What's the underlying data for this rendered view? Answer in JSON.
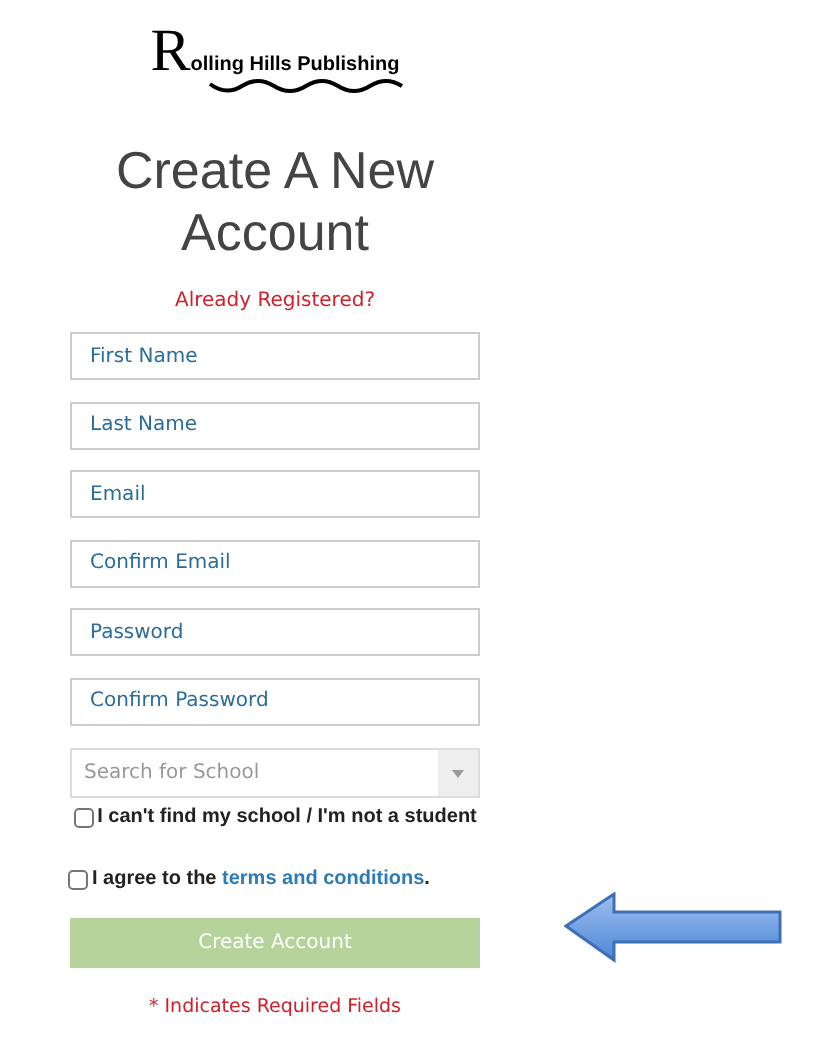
{
  "logo": "Rolling Hills Publishing",
  "title": "Create A New Account",
  "login_link": "Already Registered?",
  "fields": [
    {
      "placeholder": "First Name"
    },
    {
      "placeholder": "Last Name"
    },
    {
      "placeholder": "Email"
    },
    {
      "placeholder": "Confirm Email"
    },
    {
      "placeholder": "Password"
    },
    {
      "placeholder": "Confirm Password"
    }
  ],
  "school_select": {
    "placeholder": "Search for School"
  },
  "no_school": {
    "label": "I can't find my school / I'm not a student",
    "checked": false
  },
  "agree": {
    "prefix": "I agree to the ",
    "link": "terms and conditions",
    "suffix": ".",
    "checked": false
  },
  "submit": {
    "label": "Create Account",
    "disabled": true
  },
  "required_note": "* Indicates Required Fields"
}
